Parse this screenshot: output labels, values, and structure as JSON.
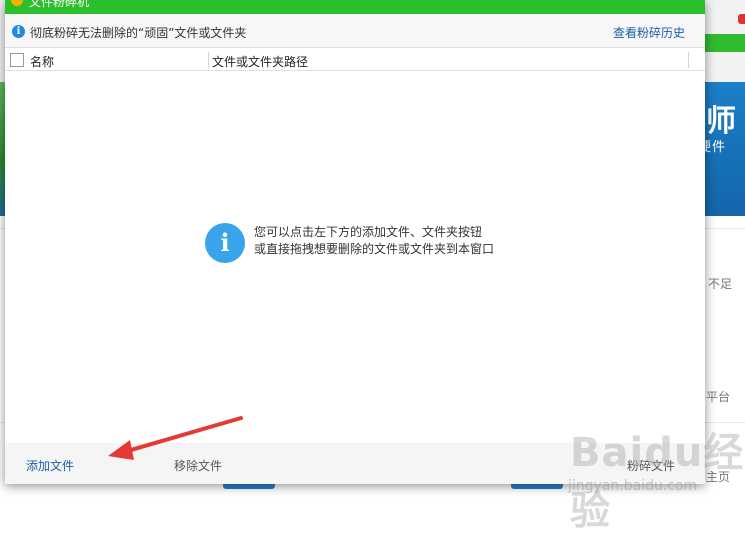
{
  "window": {
    "title": "文件粉碎机"
  },
  "info_bar": {
    "text": "彻底粉碎无法删除的“顽固”文件或文件夹",
    "history_link": "查看粉碎历史"
  },
  "table": {
    "columns": [
      "名称",
      "文件或文件夹路径"
    ]
  },
  "empty_state": {
    "line1": "您可以点击左下方的添加文件、文件夹按钮",
    "line2": "或直接拖拽想要删除的文件或文件夹到本窗口"
  },
  "bottom_bar": {
    "add_button": "添加文件",
    "remove_button": "移除文件",
    "shred_button": "粉碎文件"
  },
  "background": {
    "banner_big": "师",
    "banner_small": "硬件",
    "text_1": "不足",
    "text_2": "平台",
    "text_3": "主页"
  },
  "watermark": {
    "main": "Baidu经验",
    "sub": "jingyan.baidu.com"
  },
  "colors": {
    "title_bar": "#2cbf2c",
    "link": "#1a5fa8",
    "info_icon": "#1e88e5",
    "arrow": "#e53935"
  }
}
